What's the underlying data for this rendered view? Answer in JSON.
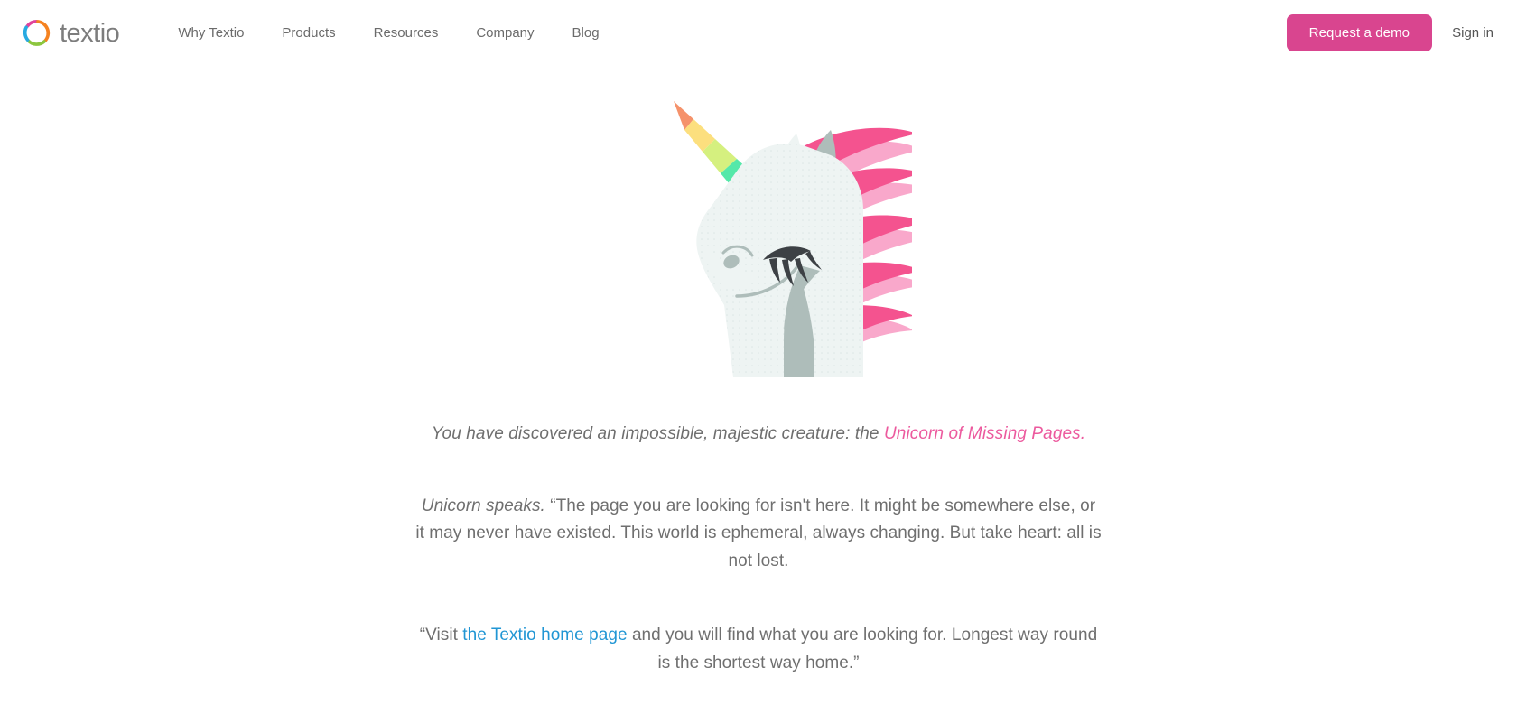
{
  "header": {
    "brand": {
      "icon": "textio-ring-logo",
      "wordmark": "textio",
      "logo_colors": {
        "magenta": "#e0439b",
        "orange": "#f58220",
        "green": "#8cc63e",
        "blue": "#27aae1"
      }
    },
    "nav": [
      {
        "label": "Why Textio",
        "name": "nav-why-textio"
      },
      {
        "label": "Products",
        "name": "nav-products"
      },
      {
        "label": "Resources",
        "name": "nav-resources"
      },
      {
        "label": "Company",
        "name": "nav-company"
      },
      {
        "label": "Blog",
        "name": "nav-blog"
      }
    ],
    "cta": {
      "label": "Request a demo",
      "background": "#d9458f",
      "text_color": "#ffffff"
    },
    "signin": {
      "label": "Sign in"
    }
  },
  "main": {
    "illustration": {
      "name": "unicorn-illustration",
      "alt": "Unicorn of Missing Pages",
      "colors": {
        "body": "#eef4f3",
        "body_shadow": "#aebdba",
        "mane_dark": "#f4538f",
        "mane_light": "#f9a8cb",
        "eye": "#3d4145",
        "horn_orange": "#f5926b",
        "horn_yellow": "#fcdf7e",
        "horn_lime": "#d5f07f",
        "horn_mint": "#55e8a9",
        "horn_sky": "#6fd9f2",
        "horn_purple": "#8b7bee"
      }
    },
    "lede": {
      "text": "You have discovered an impossible, majestic creature: the ",
      "accent": "Unicorn of Missing Pages."
    },
    "paragraph_one": {
      "lead_italic": "Unicorn speaks.",
      "text": " “The page you are looking for isn't here. It might be somewhere else, or it may never have existed. This world is ephemeral, always changing. But take heart: all is not lost."
    },
    "paragraph_two": {
      "before_link": "“Visit ",
      "link_label": "the Textio home page",
      "after_link": " and you will find what you are looking for. Longest way round is the shortest way home.”"
    }
  }
}
